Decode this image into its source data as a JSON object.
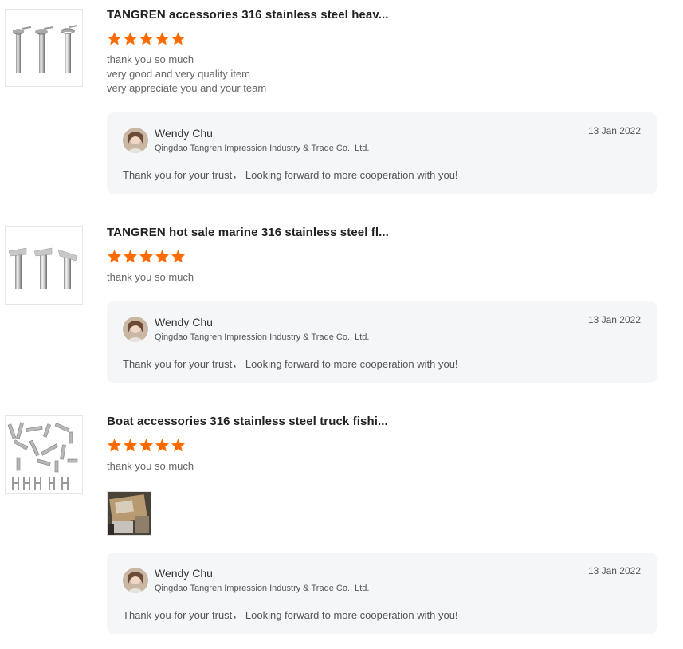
{
  "reviews": [
    {
      "title": "TANGREN accessories 316 stainless steel heav...",
      "rating": 5,
      "comment_lines": [
        "thank you so much",
        "very good and very quality item",
        "very appreciate you and your team"
      ],
      "reply": {
        "name": "Wendy Chu",
        "company": "Qingdao Tangren Impression Industry & Trade Co., Ltd.",
        "date": "13 Jan 2022",
        "message": "Thank you for your trust，  Looking forward to more cooperation with you!"
      }
    },
    {
      "title": "TANGREN hot sale marine 316 stainless steel fl...",
      "rating": 5,
      "comment_lines": [
        "thank you so much"
      ],
      "reply": {
        "name": "Wendy Chu",
        "company": "Qingdao Tangren Impression Industry & Trade Co., Ltd.",
        "date": "13 Jan 2022",
        "message": "Thank you for your trust，  Looking forward to more cooperation with you!"
      }
    },
    {
      "title": "Boat accessories 316 stainless steel truck fishi...",
      "rating": 5,
      "comment_lines": [
        "thank you so much"
      ],
      "reply": {
        "name": "Wendy Chu",
        "company": "Qingdao Tangren Impression Industry & Trade Co., Ltd.",
        "date": "13 Jan 2022",
        "message": "Thank you for your trust，  Looking forward to more cooperation with you!"
      }
    }
  ],
  "colors": {
    "star": "#ff6a00",
    "reply_bg": "#f5f6f8",
    "divider": "#d9d9d9"
  }
}
